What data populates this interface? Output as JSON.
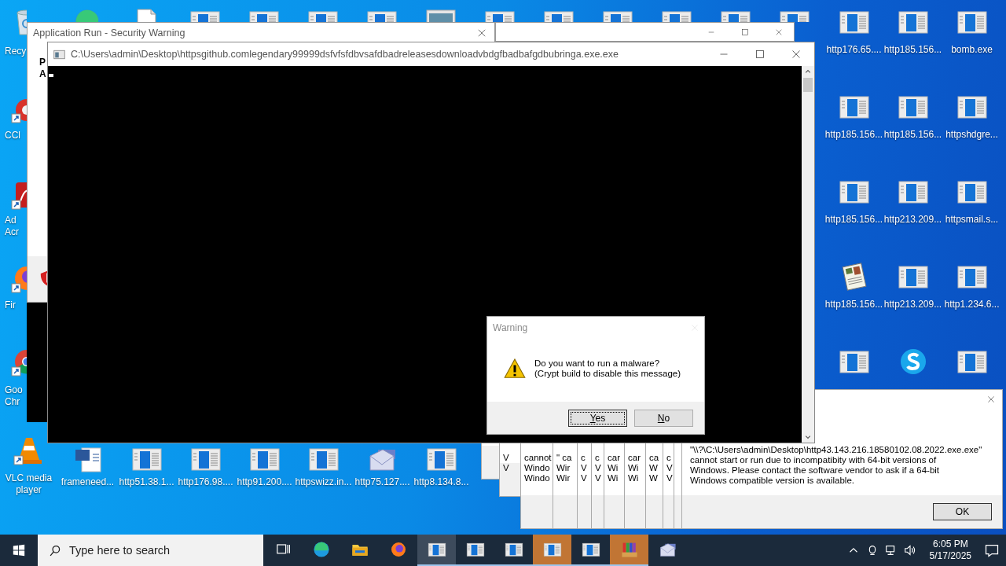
{
  "desktop": {
    "left_column": [
      {
        "kind": "recycle",
        "label": "Recy"
      },
      {
        "kind": "ccleaner",
        "label": "CCl"
      },
      {
        "kind": "acrobat",
        "label": "Ad Acr"
      },
      {
        "kind": "firefox",
        "label": "Fir"
      },
      {
        "kind": "chrome",
        "label": "Goo Chr"
      },
      {
        "kind": "vlc",
        "label": "VLC media player"
      }
    ],
    "top_row": [
      {
        "kind": "edge"
      },
      {
        "kind": "doc"
      },
      {
        "kind": "app"
      },
      {
        "kind": "app"
      },
      {
        "kind": "app"
      },
      {
        "kind": "app"
      },
      {
        "kind": "screen"
      },
      {
        "kind": "app"
      },
      {
        "kind": "app"
      },
      {
        "kind": "app"
      },
      {
        "kind": "app"
      },
      {
        "kind": "app"
      },
      {
        "kind": "app"
      }
    ],
    "bottom_row": [
      {
        "kind": "word",
        "label": "frameneed..."
      },
      {
        "kind": "app",
        "label": "http51.38.1..."
      },
      {
        "kind": "app",
        "label": "http176.98...."
      },
      {
        "kind": "app",
        "label": "http91.200...."
      },
      {
        "kind": "app",
        "label": "httpswizz.in..."
      },
      {
        "kind": "mail",
        "label": "http75.127...."
      },
      {
        "kind": "app",
        "label": "http8.134.8..."
      }
    ],
    "right_grid": [
      [
        {
          "kind": "app",
          "label": "http176.65...."
        },
        {
          "kind": "app",
          "label": "http185.156..."
        },
        {
          "kind": "app",
          "label": "bomb.exe"
        }
      ],
      [
        {
          "kind": "app",
          "label": "http185.156..."
        },
        {
          "kind": "app",
          "label": "http185.156..."
        },
        {
          "kind": "app",
          "label": "httpshdgre..."
        }
      ],
      [
        {
          "kind": "app",
          "label": "http185.156..."
        },
        {
          "kind": "app",
          "label": "http213.209..."
        },
        {
          "kind": "app",
          "label": "httpsmail.s..."
        }
      ],
      [
        {
          "kind": "newspaper",
          "label": "http185.156..."
        },
        {
          "kind": "app",
          "label": "http213.209..."
        },
        {
          "kind": "app",
          "label": "http1.234.6..."
        }
      ],
      [
        {
          "kind": "app"
        },
        {
          "kind": "skype"
        },
        {
          "kind": "app"
        }
      ]
    ]
  },
  "security_window": {
    "title": "Application Run - Security Warning",
    "texts": [
      "P",
      "A"
    ]
  },
  "console_window": {
    "title": "C:\\Users\\admin\\Desktop\\httpsgithub.comlegendary99999dsfvfsfdbvsafdbadreleasesdownloadvbdgfbadbafgdbubringa.exe.exe"
  },
  "warning_dialog": {
    "title": "Warning",
    "message": [
      "Do you want to run a malware?",
      "(Crypt build to disable this message)"
    ],
    "buttons": [
      {
        "label": "Yes",
        "focused": true
      },
      {
        "label": "No",
        "focused": false
      }
    ]
  },
  "error_dialogs": {
    "slivers": [
      {
        "kind": "blank"
      },
      {
        "kind": "text",
        "lines": [
          "V",
          "V"
        ]
      },
      {
        "kind": "text",
        "lines": [
          "cannot",
          "Windo",
          "Windo"
        ]
      },
      {
        "kind": "text",
        "lines": [
          "\" ca",
          "Wir",
          "Wir"
        ]
      },
      {
        "kind": "text",
        "lines": [
          "c",
          "V",
          "V"
        ]
      },
      {
        "kind": "text",
        "lines": [
          "c",
          "V",
          "V"
        ]
      },
      {
        "kind": "text",
        "lines": [
          "car",
          "Wi",
          "Wi"
        ]
      },
      {
        "kind": "text",
        "lines": [
          "car",
          "Wi",
          "Wi"
        ]
      },
      {
        "kind": "text",
        "lines": [
          "ca",
          "W",
          "W"
        ]
      },
      {
        "kind": "text",
        "lines": [
          "c",
          "V",
          "V"
        ]
      },
      {
        "kind": "blank"
      }
    ],
    "message": [
      "\"\\\\?\\C:\\Users\\admin\\Desktop\\http43.143.216.18580102.08.2022.exe.exe\"",
      "cannot start or run due to incompatibity with 64-bit versions of",
      "Windows. Please contact the software vendor to ask if a 64-bit",
      "Windows compatible version is available."
    ],
    "button": "OK"
  },
  "taskbar": {
    "search": {
      "placeholder": "Type here to search"
    },
    "items": [
      {
        "kind": "task-view",
        "active": false,
        "open": false,
        "flashing": false
      },
      {
        "kind": "edge",
        "active": false,
        "open": false,
        "flashing": false
      },
      {
        "kind": "explorer",
        "active": false,
        "open": false,
        "flashing": false
      },
      {
        "kind": "firefox",
        "active": false,
        "open": false,
        "flashing": false
      },
      {
        "kind": "app",
        "active": true,
        "open": true,
        "flashing": false
      },
      {
        "kind": "app",
        "active": false,
        "open": true,
        "flashing": false
      },
      {
        "kind": "app",
        "active": false,
        "open": true,
        "flashing": false
      },
      {
        "kind": "app",
        "active": false,
        "open": true,
        "flashing": true
      },
      {
        "kind": "app",
        "active": false,
        "open": true,
        "flashing": false
      },
      {
        "kind": "archive",
        "active": false,
        "open": true,
        "flashing": true
      },
      {
        "kind": "mail",
        "active": false,
        "open": false,
        "flashing": false
      }
    ],
    "time": "6:05 PM",
    "date": "5/17/2025"
  }
}
